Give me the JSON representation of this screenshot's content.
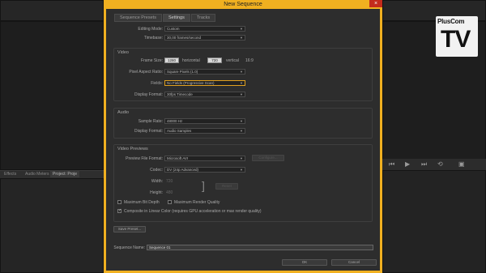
{
  "window": {
    "title": "New Sequence",
    "close_glyph": "×"
  },
  "tabs": [
    "Sequence Presets",
    "Settings",
    "Tracks"
  ],
  "settings": {
    "editing_mode": {
      "label": "Editing Mode:",
      "value": "Custom"
    },
    "timebase": {
      "label": "Timebase:",
      "value": "30,00 frames/second"
    },
    "video": {
      "title": "Video",
      "frame_size_label": "Frame Size:",
      "width": "1280",
      "horizontal_label": "horizontal",
      "height": "720",
      "vertical_label": "vertical",
      "aspect": "16:9",
      "pixel_aspect_label": "Pixel Aspect Ratio:",
      "pixel_aspect_value": "Square Pixels (1.0)",
      "fields_label": "Fields:",
      "fields_value": "No Fields (Progressive Scan)",
      "display_format_label": "Display Format:",
      "display_format_value": "30fps Timecode"
    },
    "audio": {
      "title": "Audio",
      "sample_rate_label": "Sample Rate:",
      "sample_rate_value": "48000 Hz",
      "display_format_label": "Display Format:",
      "display_format_value": "Audio Samples"
    },
    "previews": {
      "title": "Video Previews",
      "file_format_label": "Preview File Format:",
      "file_format_value": "Microsoft AVI",
      "configure_label": "Configure...",
      "codec_label": "Codec:",
      "codec_value": "DV (24p Advanced)",
      "width_label": "Width:",
      "width_value": "720",
      "height_label": "Height:",
      "height_value": "480",
      "reset_label": "Reset",
      "max_bit_depth": "Maximum Bit Depth",
      "max_render_quality": "Maximum Render Quality",
      "composite_linear": "Composite in Linear Color (requires GPU acceleration or max render quality)"
    },
    "save_preset_label": "Save Preset...",
    "sequence_name_label": "Sequence Name:",
    "sequence_name_value": "Sequence 01",
    "ok_label": "OK",
    "cancel_label": "Cancel"
  },
  "background": {
    "left_tabs": [
      "Effects",
      "Audio Meters",
      "Project: Proje"
    ],
    "watermark_top": "PlusCom",
    "watermark_bottom": "TV"
  }
}
